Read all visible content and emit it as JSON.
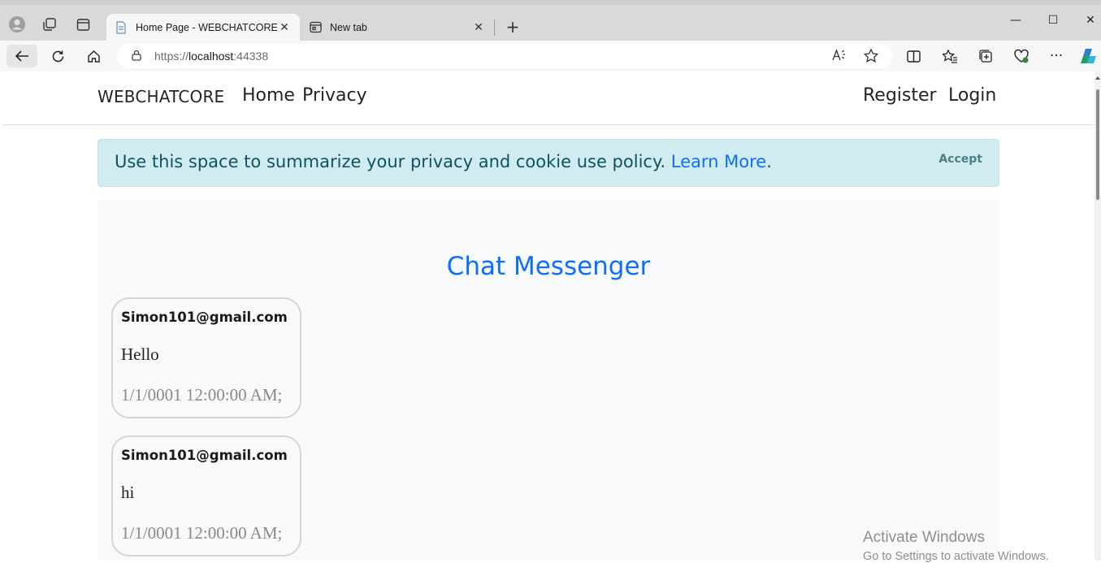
{
  "browser": {
    "tabs": [
      {
        "title": "Home Page - WEBCHATCORE",
        "active": true,
        "favicon": "page-icon"
      },
      {
        "title": "New tab",
        "active": false,
        "favicon": "newtab-icon"
      }
    ],
    "url": {
      "scheme": "https://",
      "host": "localhost",
      "port": ":44338"
    },
    "window_controls": {
      "minimize": "—",
      "maximize": "☐",
      "close": "✕"
    }
  },
  "navbar": {
    "brand": "WEBCHATCORE",
    "links": [
      "Home",
      "Privacy"
    ],
    "right_links": [
      "Register",
      "Login"
    ]
  },
  "cookie_banner": {
    "text": "Use this space to summarize your privacy and cookie use policy.",
    "link_text": "Learn More",
    "suffix": ".",
    "accept_label": "Accept"
  },
  "chat": {
    "title": "Chat Messenger",
    "messages": [
      {
        "user": "Simon101@gmail.com",
        "text": "Hello",
        "time": "1/1/0001 12:00:00 AM;"
      },
      {
        "user": "Simon101@gmail.com",
        "text": "hi",
        "time": "1/1/0001 12:00:00 AM;"
      }
    ]
  },
  "watermark": {
    "title": "Activate Windows",
    "subtitle": "Go to Settings to activate Windows."
  },
  "colors": {
    "link": "#0d6efd",
    "cookie_bg": "#d1ecf1",
    "cookie_text": "#0c5460",
    "panel_bg": "#f8f9fa"
  }
}
